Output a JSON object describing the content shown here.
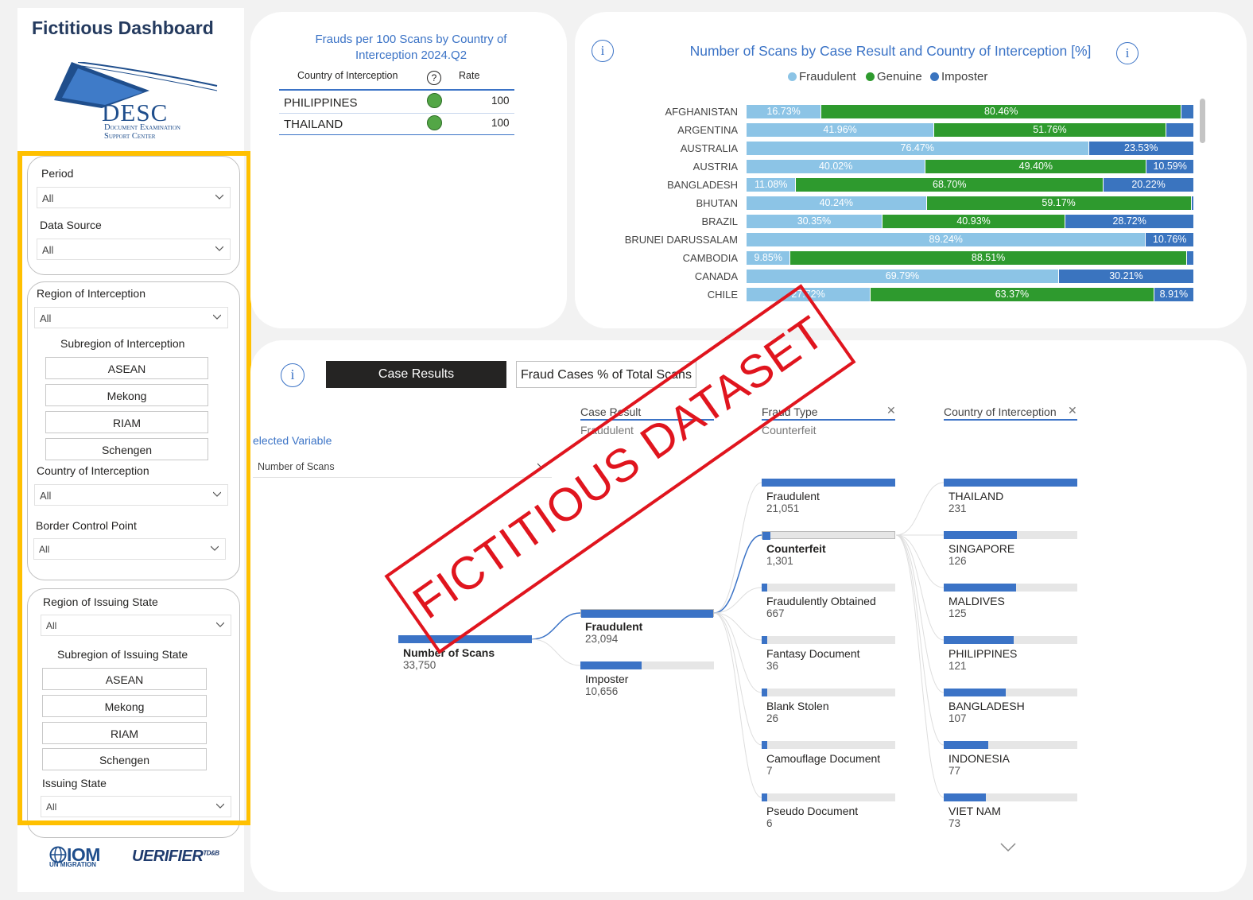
{
  "app": {
    "title": "Fictitious Dashboard"
  },
  "logo": {
    "name": "DESC",
    "sub1": "Document Examination",
    "sub2": "Support Center"
  },
  "filters": {
    "period": {
      "label": "Period",
      "value": "All"
    },
    "data_source": {
      "label": "Data Source",
      "value": "All"
    },
    "region_interception": {
      "label": "Region of Interception",
      "value": "All"
    },
    "subregion_interception": {
      "label": "Subregion of Interception",
      "tiles": [
        "ASEAN",
        "Mekong",
        "RIAM",
        "Schengen"
      ]
    },
    "country_interception": {
      "label": "Country of Interception",
      "value": "All"
    },
    "border_control_point": {
      "label": "Border Control Point",
      "value": "All"
    },
    "region_issuing": {
      "label": "Region of Issuing State",
      "value": "All"
    },
    "subregion_issuing": {
      "label": "Subregion of Issuing State",
      "tiles": [
        "ASEAN",
        "Mekong",
        "RIAM",
        "Schengen"
      ]
    },
    "issuing_state": {
      "label": "Issuing State",
      "value": "All"
    }
  },
  "footer": {
    "iom": "IOM",
    "iom_sub": "UN MIGRATION",
    "verifier": "UERIFIER",
    "verifier_sup": "TD&B"
  },
  "frauds_table": {
    "title_line1": "Frauds per 100 Scans by Country of",
    "title_line2": "Interception 2024.Q2",
    "col_country": "Country of Interception",
    "col_rate": "Rate",
    "help_icon": "?",
    "rows": [
      {
        "country": "PHILIPPINES",
        "rate": "100"
      },
      {
        "country": "THAILAND",
        "rate": "100"
      }
    ]
  },
  "scans_chart_title": "Number of Scans by Case Result and Country of Interception [%]",
  "info_icon": "i",
  "colors": {
    "fraudulent": "#8cc4e6",
    "genuine": "#2e9a2e",
    "imposter": "#3a74bf",
    "accent": "#3b73c6",
    "stamp": "#e0151e",
    "highlight": "#ffc000"
  },
  "chart_data": {
    "type": "bar",
    "orientation": "horizontal",
    "stacked": true,
    "normalized": true,
    "legend": "top",
    "categories": [
      "AFGHANISTAN",
      "ARGENTINA",
      "AUSTRALIA",
      "AUSTRIA",
      "BANGLADESH",
      "BHUTAN",
      "BRAZIL",
      "BRUNEI DARUSSALAM",
      "CAMBODIA",
      "CANADA",
      "CHILE"
    ],
    "series": [
      {
        "name": "Fraudulent",
        "values": [
          16.73,
          41.96,
          76.47,
          40.02,
          11.08,
          40.24,
          30.35,
          89.24,
          9.85,
          69.79,
          27.72
        ],
        "labels": [
          "16.73%",
          "41.96%",
          "76.47%",
          "40.02%",
          "11.08%",
          "40.24%",
          "30.35%",
          "89.24%",
          "9.85%",
          "69.79%",
          "27.72%"
        ]
      },
      {
        "name": "Genuine",
        "values": [
          80.46,
          51.76,
          0,
          49.4,
          68.7,
          59.17,
          40.93,
          0,
          88.51,
          0,
          63.37
        ],
        "labels": [
          "80.46%",
          "51.76%",
          "",
          "49.40%",
          "68.70%",
          "59.17%",
          "40.93%",
          "",
          "88.51%",
          "",
          "63.37%"
        ]
      },
      {
        "name": "Imposter",
        "values": [
          2.81,
          6.28,
          23.53,
          10.59,
          20.22,
          0.59,
          28.72,
          10.76,
          1.64,
          30.21,
          8.91
        ],
        "labels": [
          "",
          "",
          "23.53%",
          "10.59%",
          "20.22%",
          "",
          "28.72%",
          "10.76%",
          "",
          "30.21%",
          "8.91%"
        ]
      }
    ]
  },
  "decomp": {
    "tab_active": "Case Results",
    "tab_other": "Fraud Cases % of Total Scans",
    "selected_variable_label": "elected Variable",
    "selected_variable_value": "Number of Scans",
    "levels": [
      {
        "header": "Case Result",
        "selected": "Fraudulent"
      },
      {
        "header": "Fraud Type",
        "selected": "Counterfeit"
      },
      {
        "header": "Country of Interception",
        "selected": ""
      }
    ],
    "root": {
      "label": "Number of Scans",
      "value": "33,750",
      "share": 1.0
    },
    "case_results": [
      {
        "label": "Fraudulent",
        "value": "23,094",
        "share": 1.0
      },
      {
        "label": "Imposter",
        "value": "10,656",
        "share": 0.461
      }
    ],
    "fraud_types": [
      {
        "label": "Fraudulent",
        "value": "21,051",
        "share": 1.0
      },
      {
        "label": "Counterfeit",
        "value": "1,301",
        "share": 0.062
      },
      {
        "label": "Fraudulently Obtained",
        "value": "667",
        "share": 0.032
      },
      {
        "label": "Fantasy Document",
        "value": "36",
        "share": 0.002
      },
      {
        "label": "Blank Stolen",
        "value": "26",
        "share": 0.0012
      },
      {
        "label": "Camouflage Document",
        "value": "7",
        "share": 0.0003
      },
      {
        "label": "Pseudo Document",
        "value": "6",
        "share": 0.0003
      }
    ],
    "countries": [
      {
        "label": "THAILAND",
        "value": "231",
        "share": 1.0
      },
      {
        "label": "SINGAPORE",
        "value": "126",
        "share": 0.545
      },
      {
        "label": "MALDIVES",
        "value": "125",
        "share": 0.541
      },
      {
        "label": "PHILIPPINES",
        "value": "121",
        "share": 0.524
      },
      {
        "label": "BANGLADESH",
        "value": "107",
        "share": 0.463
      },
      {
        "label": "INDONESIA",
        "value": "77",
        "share": 0.333
      },
      {
        "label": "VIET NAM",
        "value": "73",
        "share": 0.316
      }
    ]
  },
  "watermark": "FICTITIOUS DATASET"
}
